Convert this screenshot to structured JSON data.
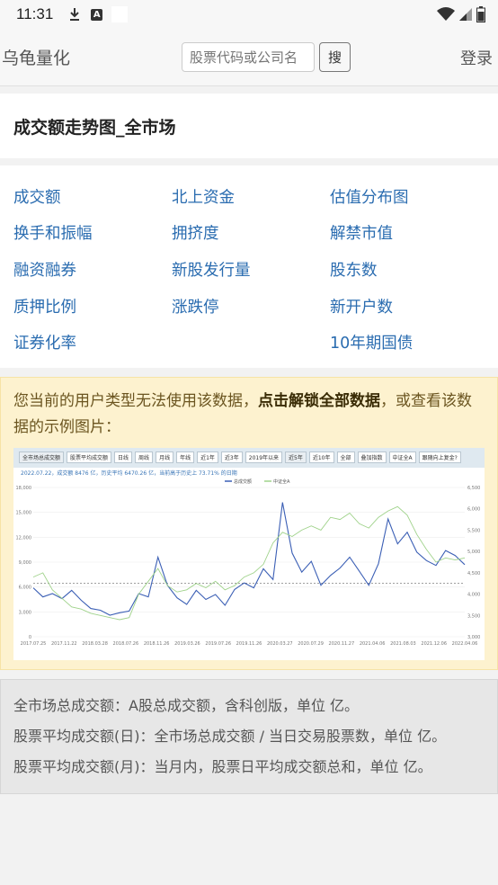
{
  "statusbar": {
    "time": "11:31",
    "icons": [
      "download-icon",
      "a-icon",
      "wifi-icon",
      "signal-icon",
      "battery-icon"
    ]
  },
  "navbar": {
    "brand": "乌龟量化",
    "search_placeholder": "股票代码或公司名",
    "search_button": "搜",
    "login": "登录"
  },
  "page": {
    "title": "成交额走势图_全市场"
  },
  "links": [
    "成交额",
    "北上资金",
    "估值分布图",
    "换手和振幅",
    "拥挤度",
    "解禁市值",
    "融资融券",
    "新股发行量",
    "股东数",
    "质押比例",
    "涨跌停",
    "新开户数",
    "证券化率",
    "",
    "10年期国债"
  ],
  "notice": {
    "text_before": "您当前的用户类型无法使用该数据，",
    "unlock": "点击解锁全部数据",
    "text_after": "，或查看该数据的示例图片："
  },
  "chart_toolbar": [
    "全市场总成交额",
    "股票平均成交额",
    "日线",
    "周线",
    "月线",
    "年线",
    "近1年",
    "近3年",
    "2019年以来",
    "近5年",
    "近10年",
    "全部",
    "叠加指数",
    "中证全A",
    "跟随向上复金?"
  ],
  "chart_info": "2022.07.22，成交额 8476 亿，历史平均 6470.26 亿，当前高于历史上 73.71% 的日期",
  "chart_data": {
    "type": "line",
    "title": "",
    "legend": [
      "总成交额",
      "中证全A"
    ],
    "x_ticks": [
      "2017.07.25",
      "2017.11.22",
      "2018.03.28",
      "2018.07.26",
      "2018.11.26",
      "2019.03.26",
      "2019.07.26",
      "2019.11.26",
      "2020.03.27",
      "2020.07.29",
      "2020.11.27",
      "2021.04.06",
      "2021.08.03",
      "2021.12.06",
      "2022.04.06"
    ],
    "y_left": {
      "ticks": [
        0,
        3000,
        6000,
        9000,
        12000,
        15000,
        18000
      ],
      "range": [
        0,
        18000
      ]
    },
    "y_right": {
      "ticks": [
        3000,
        3500,
        4000,
        4500,
        5000,
        5500,
        6000,
        6500
      ],
      "range": [
        3000,
        6500
      ]
    },
    "average_line": 6470.26,
    "series": [
      {
        "name": "总成交额",
        "values": [
          5900,
          4800,
          5200,
          4600,
          5600,
          4400,
          3400,
          3200,
          2600,
          2900,
          3100,
          5200,
          4800,
          9600,
          6200,
          4700,
          3900,
          5600,
          4500,
          5100,
          3800,
          5700,
          6500,
          5900,
          8200,
          6900,
          16200,
          10100,
          7800,
          9100,
          6200,
          7400,
          8300,
          9600,
          7900,
          6200,
          8800,
          14200,
          11200,
          12600,
          10200,
          9200,
          8600,
          10400,
          9800,
          8700
        ]
      },
      {
        "name": "中证全A",
        "values": [
          4400,
          4500,
          4100,
          3900,
          3700,
          3650,
          3550,
          3500,
          3450,
          3400,
          3450,
          4000,
          4300,
          4600,
          4200,
          4050,
          4100,
          4250,
          4150,
          4300,
          4100,
          4200,
          4400,
          4500,
          4700,
          5200,
          5450,
          5350,
          5500,
          5600,
          5500,
          5800,
          5750,
          5900,
          5650,
          5550,
          5800,
          5950,
          6050,
          5850,
          5400,
          5050,
          4750,
          4850,
          4800,
          4850
        ]
      }
    ]
  },
  "notes": [
    "全市场总成交额：A股总成交额，含科创版，单位 亿。",
    "股票平均成交额(日)：全市场总成交额 / 当日交易股票数，单位 亿。",
    "股票平均成交额(月)：当月内，股票日平均成交额总和，单位 亿。"
  ]
}
